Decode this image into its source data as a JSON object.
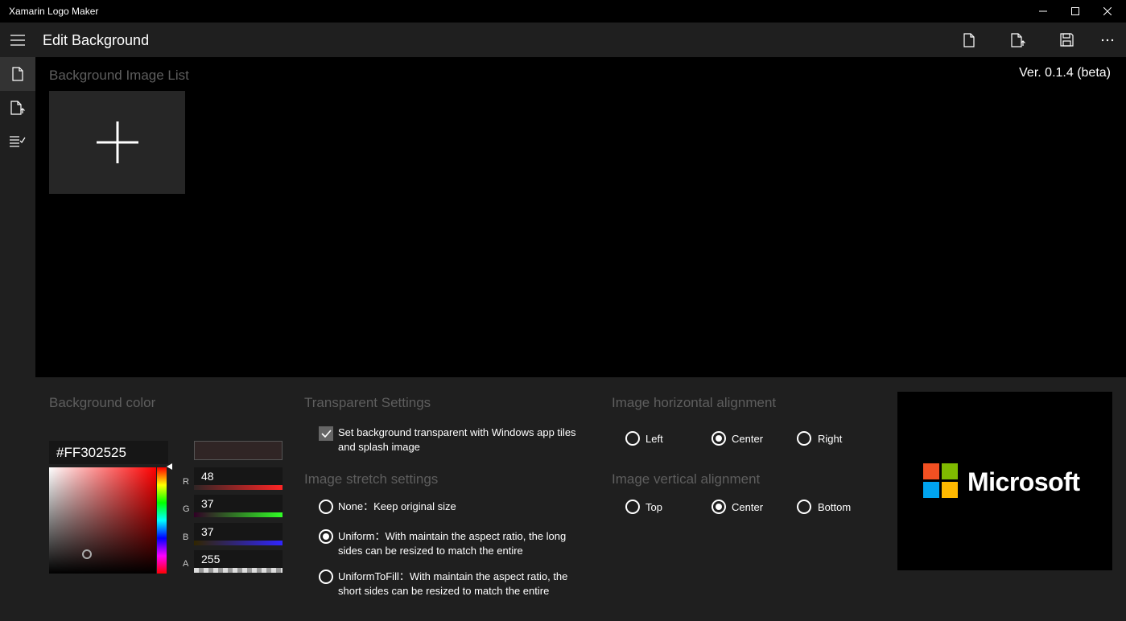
{
  "window": {
    "title": "Xamarin Logo Maker"
  },
  "header": {
    "title": "Edit Background"
  },
  "main": {
    "image_list_label": "Background Image List",
    "version": "Ver. 0.1.4 (beta)"
  },
  "colors": {
    "background_color": "#302525",
    "accent_bg": "#1f1f1f"
  },
  "background_color": {
    "label": "Background color",
    "hex": "#FF302525",
    "channels": [
      {
        "letter": "R",
        "value": "48"
      },
      {
        "letter": "G",
        "value": "37"
      },
      {
        "letter": "B",
        "value": "37"
      },
      {
        "letter": "A",
        "value": "255"
      }
    ]
  },
  "transparent": {
    "label": "Transparent Settings",
    "checkbox_line1": "Set background transparent with Windows app tiles",
    "checkbox_line2": "and splash image"
  },
  "stretch": {
    "label": "Image stretch settings",
    "none": "None：Keep original size",
    "uniform_line1": "Uniform：With maintain the aspect ratio, the long",
    "uniform_line2": "sides can be resized to match the entire",
    "uniformtofill_line1": "UniformToFill：With maintain the aspect ratio, the",
    "uniformtofill_line2": "short sides can be resized to match the entire"
  },
  "h_align": {
    "label": "Image horizontal alignment",
    "left": "Left",
    "center": "Center",
    "right": "Right"
  },
  "v_align": {
    "label": "Image vertical alignment",
    "top": "Top",
    "center": "Center",
    "bottom": "Bottom"
  },
  "preview": {
    "logo_text": "Microsoft"
  }
}
